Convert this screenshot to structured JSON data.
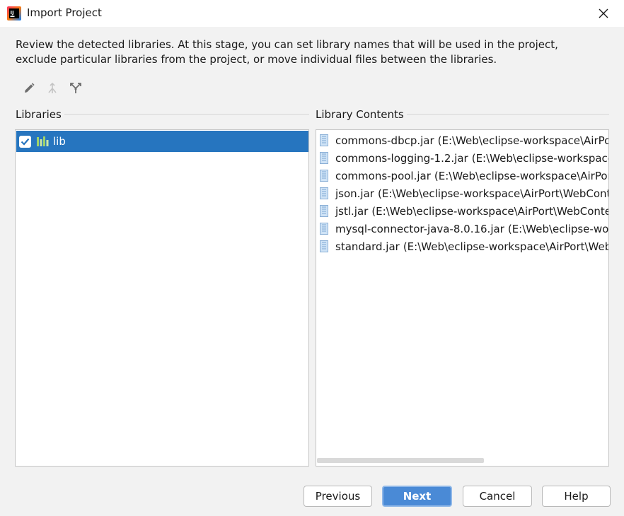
{
  "window": {
    "title": "Import Project",
    "app_icon": "intellij-idea-icon",
    "close_icon": "close-icon"
  },
  "description": {
    "line1": "Review the detected libraries. At this stage, you can set library names that will be used in the project,",
    "line2": "exclude particular libraries from the project, or move individual files between the libraries."
  },
  "toolbar": {
    "items": [
      {
        "icon": "edit-pencil-icon",
        "enabled": true
      },
      {
        "icon": "merge-icon",
        "enabled": false
      },
      {
        "icon": "split-icon",
        "enabled": true
      }
    ]
  },
  "libraries": {
    "label": "Libraries",
    "items": [
      {
        "name": "lib",
        "checked": true,
        "selected": true,
        "icon": "library-icon"
      }
    ]
  },
  "contents": {
    "label": "Library Contents",
    "files": [
      {
        "name": "commons-dbcp.jar",
        "path": "(E:\\Web\\eclipse-workspace\\AirPo"
      },
      {
        "name": "commons-logging-1.2.jar",
        "path": "(E:\\Web\\eclipse-workspace"
      },
      {
        "name": "commons-pool.jar",
        "path": "(E:\\Web\\eclipse-workspace\\AirPor"
      },
      {
        "name": "json.jar",
        "path": "(E:\\Web\\eclipse-workspace\\AirPort\\WebCont"
      },
      {
        "name": "jstl.jar",
        "path": "(E:\\Web\\eclipse-workspace\\AirPort\\WebConte"
      },
      {
        "name": "mysql-connector-java-8.0.16.jar",
        "path": "(E:\\Web\\eclipse-work"
      },
      {
        "name": "standard.jar",
        "path": "(E:\\Web\\eclipse-workspace\\AirPort\\WebCon"
      }
    ],
    "file_icon": "jar-file-icon"
  },
  "buttons": {
    "previous": "Previous",
    "next": "Next",
    "cancel": "Cancel",
    "help": "Help"
  },
  "colors": {
    "selection": "#2675bf",
    "primary_button": "#4a8ad6",
    "background": "#f2f2f2"
  }
}
